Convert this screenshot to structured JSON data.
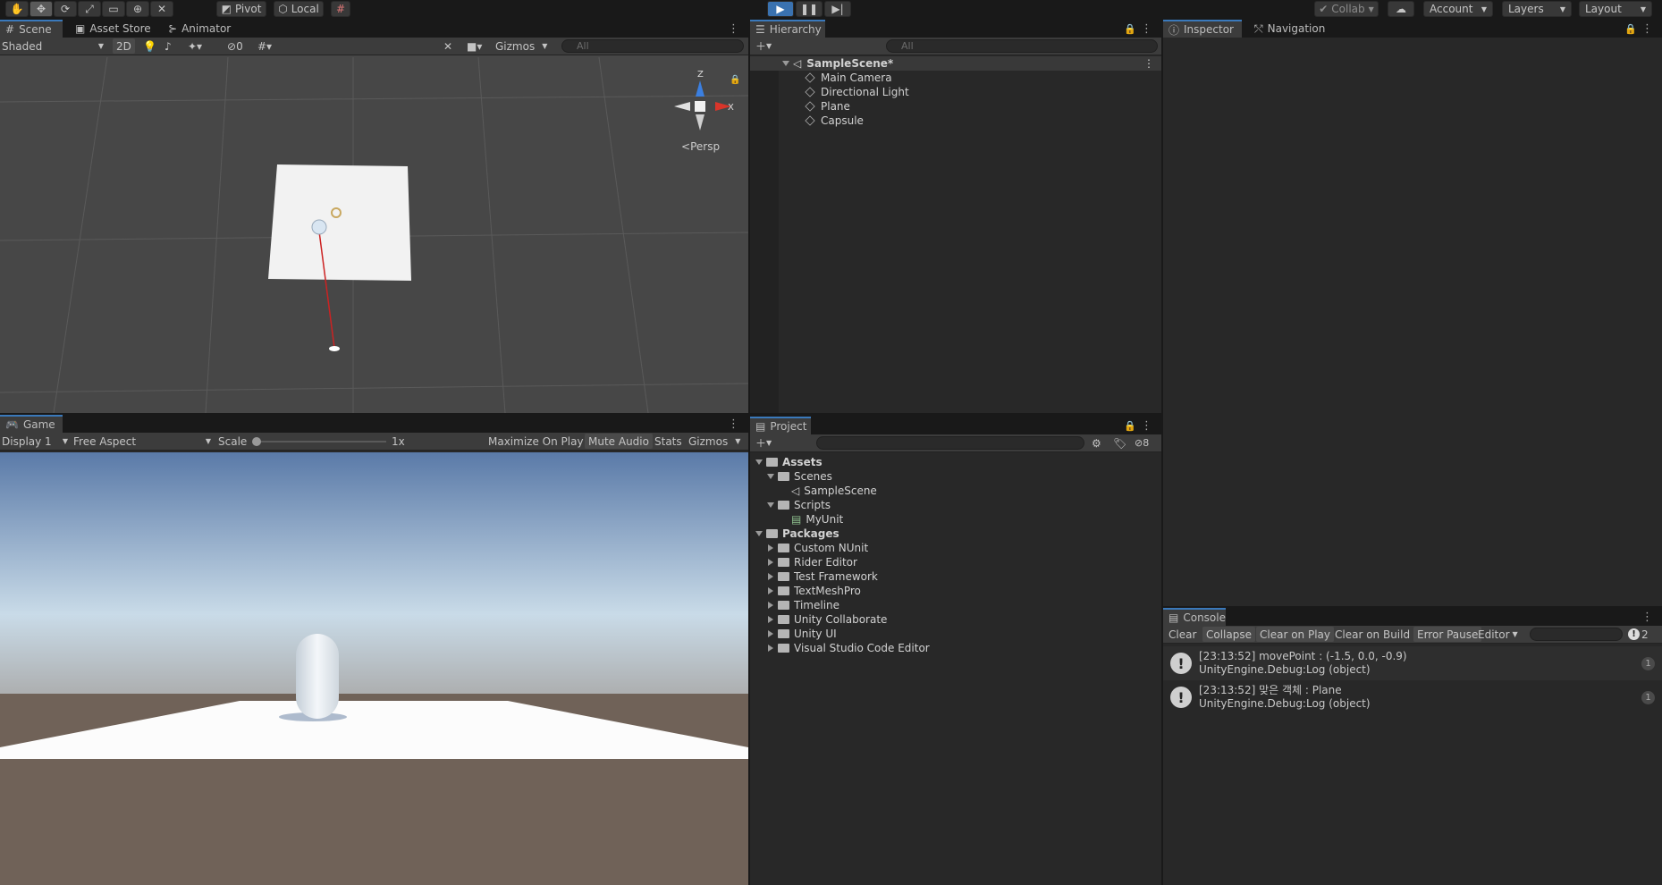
{
  "toolbar": {
    "pivot": "Pivot",
    "local": "Local",
    "collab": "Collab",
    "account": "Account",
    "layers": "Layers",
    "layout": "Layout"
  },
  "scene": {
    "tabs": [
      "Scene",
      "Asset Store",
      "Animator"
    ],
    "shading": "Shaded",
    "mode_2d": "2D",
    "hidden_count": "0",
    "gizmos": "Gizmos",
    "search_placeholder": "All",
    "persp": "Persp",
    "axis_y": "Z",
    "axis_x": "X"
  },
  "game": {
    "tab": "Game",
    "display": "Display 1",
    "aspect": "Free Aspect",
    "scale_label": "Scale",
    "scale_value": "1x",
    "maximize": "Maximize On Play",
    "mute": "Mute Audio",
    "stats": "Stats",
    "gizmos": "Gizmos"
  },
  "hierarchy": {
    "tab": "Hierarchy",
    "search_placeholder": "All",
    "scene": "SampleScene*",
    "items": [
      "Main Camera",
      "Directional Light",
      "Plane",
      "Capsule"
    ]
  },
  "project": {
    "tab": "Project",
    "hidden_count": "8",
    "tree": [
      {
        "label": "Assets",
        "level": 0,
        "type": "folder-open",
        "bold": true
      },
      {
        "label": "Scenes",
        "level": 1,
        "type": "folder-open"
      },
      {
        "label": "SampleScene",
        "level": 2,
        "type": "scene"
      },
      {
        "label": "Scripts",
        "level": 1,
        "type": "folder-open"
      },
      {
        "label": "MyUnit",
        "level": 2,
        "type": "script"
      },
      {
        "label": "Packages",
        "level": 0,
        "type": "folder-open",
        "bold": true
      },
      {
        "label": "Custom NUnit",
        "level": 1,
        "type": "folder"
      },
      {
        "label": "Rider Editor",
        "level": 1,
        "type": "folder"
      },
      {
        "label": "Test Framework",
        "level": 1,
        "type": "folder"
      },
      {
        "label": "TextMeshPro",
        "level": 1,
        "type": "folder"
      },
      {
        "label": "Timeline",
        "level": 1,
        "type": "folder"
      },
      {
        "label": "Unity Collaborate",
        "level": 1,
        "type": "folder"
      },
      {
        "label": "Unity UI",
        "level": 1,
        "type": "folder"
      },
      {
        "label": "Visual Studio Code Editor",
        "level": 1,
        "type": "folder"
      }
    ]
  },
  "inspector": {
    "tabs": [
      "Inspector",
      "Navigation"
    ]
  },
  "console": {
    "tab": "Console",
    "buttons": [
      "Clear",
      "Collapse",
      "Clear on Play",
      "Clear on Build",
      "Error Pause",
      "Editor"
    ],
    "count": "2",
    "entries": [
      {
        "line1": "[23:13:52] movePoint : (-1.5, 0.0, -0.9)",
        "line2": "UnityEngine.Debug:Log (object)",
        "count": "1"
      },
      {
        "line1": "[23:13:52] 맞은 객체 : Plane",
        "line2": "UnityEngine.Debug:Log (object)",
        "count": "1"
      }
    ]
  },
  "colors": {
    "accent": "#3a79bb",
    "play": "#3a72b0",
    "panel": "#282828",
    "bar": "#3c3c3c"
  }
}
